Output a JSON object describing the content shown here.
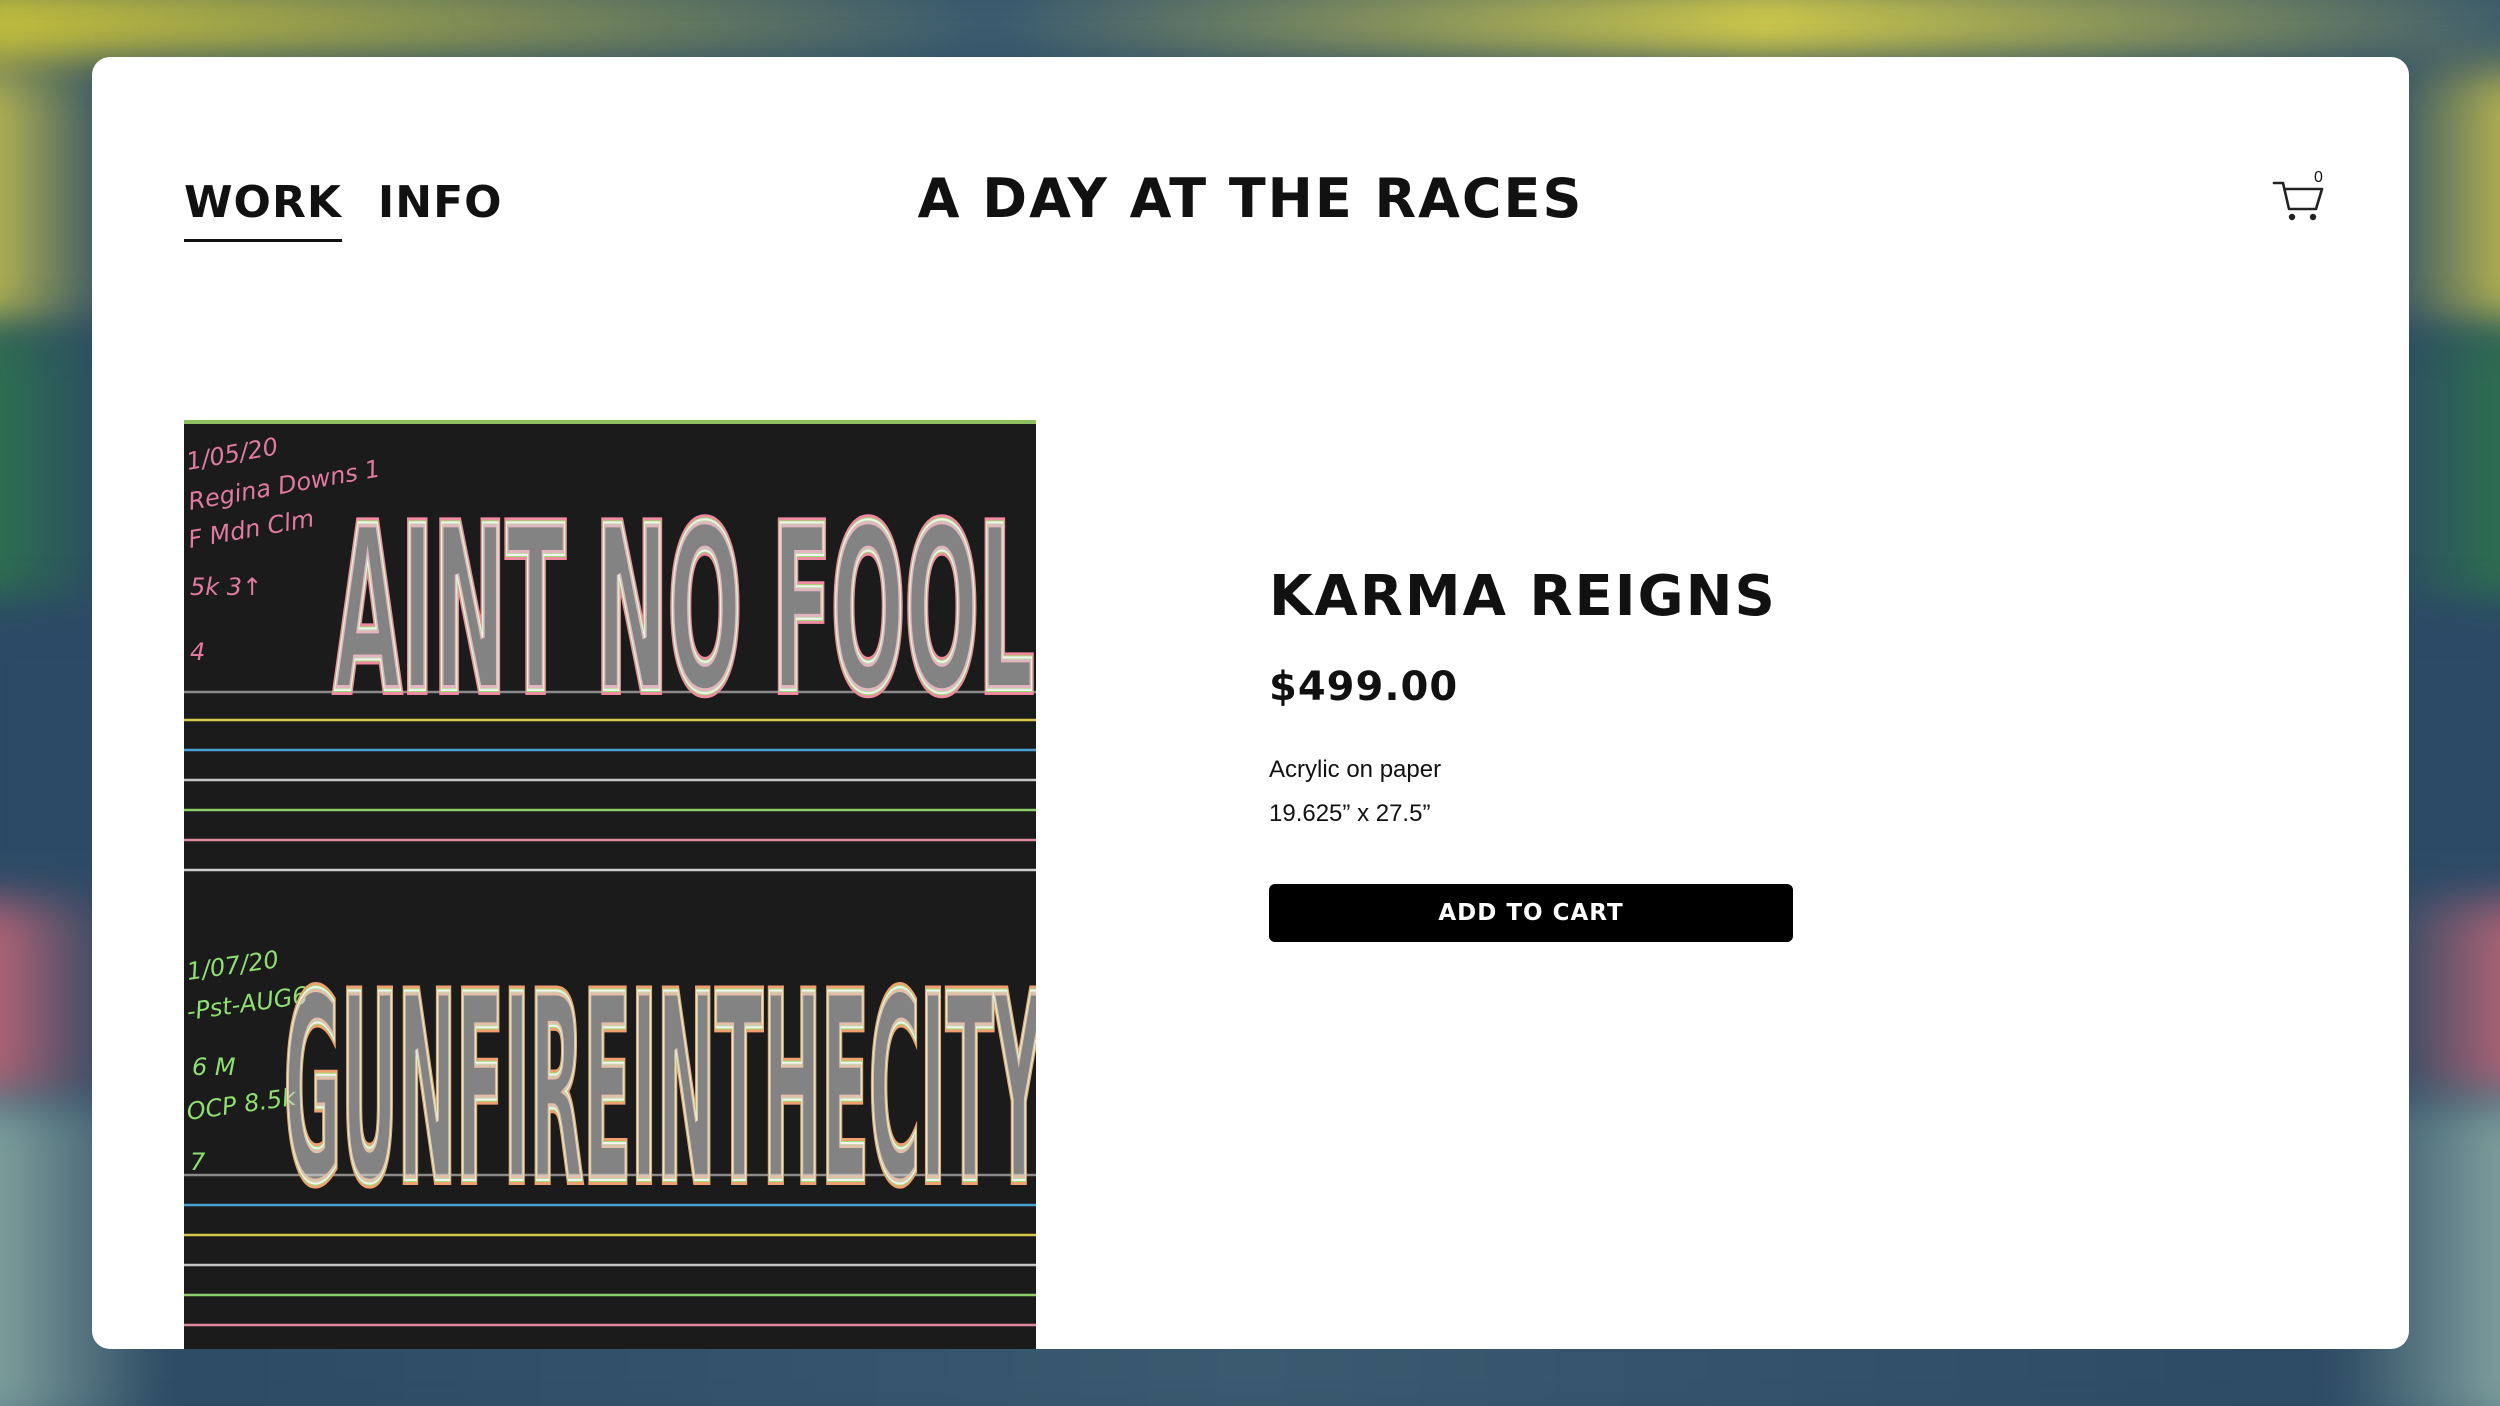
{
  "nav": {
    "items": [
      {
        "label": "WORK",
        "active": true
      },
      {
        "label": "INFO",
        "active": false
      }
    ]
  },
  "site": {
    "title": "A DAY AT THE RACES"
  },
  "cart": {
    "icon": "cart-icon",
    "count": "0"
  },
  "product": {
    "title": "KARMA REIGNS",
    "price": "$499.00",
    "medium": "Acrylic on paper",
    "dimensions": "19.625” x 27.5”",
    "add_to_cart_label": "ADD TO CART"
  },
  "artwork": {
    "top_text": "AINT NO FOOL",
    "bottom_text": "GUNFIREINTHECITY"
  },
  "colors": {
    "accent": "#000000",
    "card": "#ffffff",
    "artwork_bg": "#1b1b1b"
  }
}
